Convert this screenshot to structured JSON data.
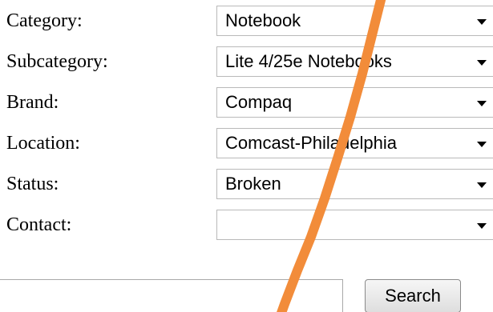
{
  "form": {
    "fields": [
      {
        "label": "Category:",
        "value": "Notebook"
      },
      {
        "label": "Subcategory:",
        "value": "Lite 4/25e Notebooks"
      },
      {
        "label": "Brand:",
        "value": "Compaq"
      },
      {
        "label": "Location:",
        "value": "Comcast-Philadelphia"
      },
      {
        "label": "Status:",
        "value": "Broken"
      },
      {
        "label": "Contact:",
        "value": ""
      }
    ],
    "search_input_value": "",
    "search_button_label": "Search"
  },
  "colors": {
    "annotation_stroke": "#f28c3a"
  },
  "icons": {
    "dropdown": "chevron-down-icon"
  }
}
